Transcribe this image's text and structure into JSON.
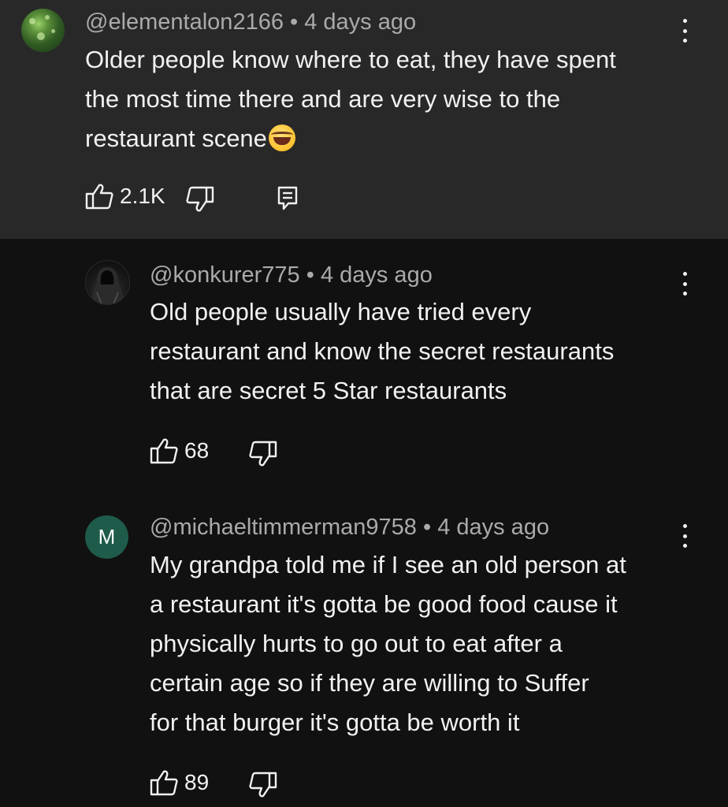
{
  "comments": [
    {
      "author": "@elementalon2166",
      "separator": "•",
      "time": "4 days ago",
      "lines": [
        "Older people know where to eat, they have spent",
        "the most time there and are very wise to the",
        "restaurant scene"
      ],
      "emoji": "face-with-tears-of-joy",
      "likes": "2.1K",
      "avatar_letter": ""
    },
    {
      "author": "@konkurer775",
      "separator": "•",
      "time": "4 days ago",
      "lines": [
        "Old people usually have tried every",
        "restaurant and know the secret restaurants",
        "that are secret 5 Star restaurants"
      ],
      "likes": "68",
      "avatar_letter": ""
    },
    {
      "author": "@michaeltimmerman9758",
      "separator": "•",
      "time": "4 days ago",
      "lines": [
        "My grandpa told me if I see an old person at",
        "a restaurant it's gotta be good food cause it",
        "physically hurts to go out to eat after a",
        "certain age so if they are willing to Suffer",
        "for that burger it's gotta be worth it"
      ],
      "likes": "89",
      "avatar_letter": "M",
      "avatar_color": "#1f5b4a"
    }
  ],
  "icons": {
    "like": "thumbs-up-icon",
    "dislike": "thumbs-down-icon",
    "reply": "reply-icon",
    "more": "more-vertical-icon"
  },
  "colors": {
    "top_background": "#282828",
    "page_background": "#111111",
    "meta_text": "#aaaaaa",
    "body_text": "#f1f1f1"
  }
}
